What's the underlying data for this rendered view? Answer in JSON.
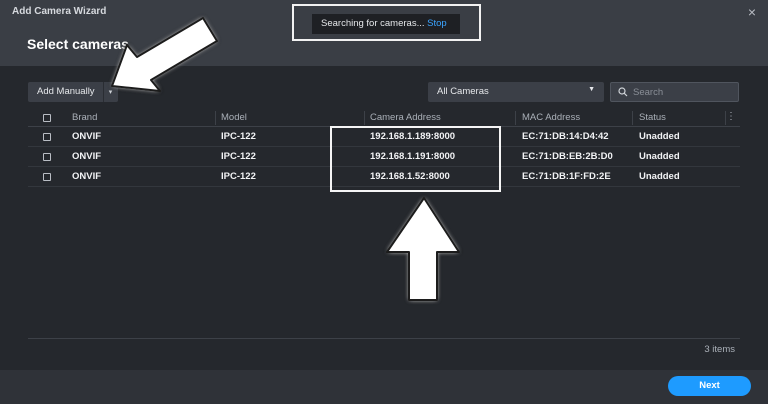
{
  "window": {
    "title": "Add Camera Wizard",
    "close_glyph": "×"
  },
  "page": {
    "title": "Select cameras"
  },
  "search_toast": {
    "text": "Searching for cameras...",
    "stop_label": "Stop"
  },
  "toolbar": {
    "add_manually_label": "Add Manually",
    "add_manually_caret": "▾",
    "filter_value": "All Cameras",
    "filter_caret": "▼",
    "search_placeholder": "Search",
    "search_icon": "search-icon"
  },
  "table": {
    "columns": [
      "Brand",
      "Model",
      "Camera Address",
      "MAC Address",
      "Status"
    ],
    "menu_glyph": "⋮",
    "rows": [
      {
        "brand": "ONVIF",
        "model": "IPC-122",
        "address": "192.168.1.189:8000",
        "mac": "EC:71:DB:14:D4:42",
        "status": "Unadded"
      },
      {
        "brand": "ONVIF",
        "model": "IPC-122",
        "address": "192.168.1.191:8000",
        "mac": "EC:71:DB:EB:2B:D0",
        "status": "Unadded"
      },
      {
        "brand": "ONVIF",
        "model": "IPC-122",
        "address": "192.168.1.52:8000",
        "mac": "EC:71:DB:1F:FD:2E",
        "status": "Unadded"
      }
    ],
    "items_count": "3 items"
  },
  "footer": {
    "next_label": "Next"
  },
  "colors": {
    "accent": "#1e9bff",
    "link": "#3ba4ff",
    "background": "#25282d",
    "header": "#3a3e45"
  }
}
